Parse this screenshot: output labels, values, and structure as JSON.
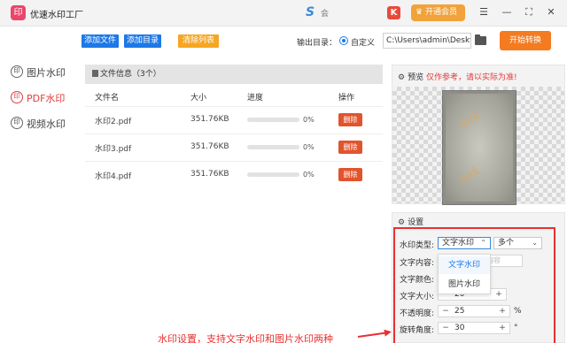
{
  "titlebar": {
    "logo_glyph": "印",
    "app_title": "优速水印工厂",
    "s_icon_glyph": "S",
    "user_label": "会",
    "k_icon_glyph": "K",
    "vip_label": "开通会员",
    "vip_icon": "crown-icon",
    "menu_glyph": "☰",
    "minimize_glyph": "—",
    "maximize_glyph": "⛶",
    "close_glyph": "✕"
  },
  "sidebar": {
    "items": [
      {
        "icon": "印",
        "label": "图片水印",
        "active": false
      },
      {
        "icon": "印",
        "label": "PDF水印",
        "active": true
      },
      {
        "icon": "印",
        "label": "视频水印",
        "active": false
      }
    ]
  },
  "toolbar": {
    "add_file": "添加文件",
    "add_folder": "添加目录",
    "clear_list": "清除列表",
    "output_label": "输出目录：",
    "custom_label": "自定义",
    "output_path": "C:\\Users\\admin\\Deskto",
    "start_label": "开始转换"
  },
  "files": {
    "header": "文件信息（3个）",
    "columns": {
      "name": "文件名",
      "size": "大小",
      "progress": "进度",
      "action": "操作"
    },
    "rows": [
      {
        "name": "水印2.pdf",
        "size": "351.76KB",
        "progress": 0,
        "progress_text": "0%",
        "action": "删除"
      },
      {
        "name": "水印3.pdf",
        "size": "351.76KB",
        "progress": 0,
        "progress_text": "0%",
        "action": "删除"
      },
      {
        "name": "水印4.pdf",
        "size": "351.76KB",
        "progress": 0,
        "progress_text": "0%",
        "action": "删除"
      }
    ]
  },
  "preview": {
    "title": "预览",
    "note": "仅作参考，请以实际为准!",
    "watermark_text": "ank"
  },
  "settings": {
    "title": "设置",
    "type_label": "水印类型:",
    "type_value": "文字水印",
    "count_value": "多个",
    "content_label": "文字内容:",
    "content_placeholder": "印内容",
    "color_label": "文字颜色:",
    "size_label": "文字大小:",
    "size_value": "20",
    "opacity_label": "不透明度:",
    "opacity_value": "25",
    "opacity_unit": "%",
    "rotate_label": "旋转角度:",
    "rotate_value": "30",
    "rotate_unit": "°",
    "dropdown_options": [
      "文字水印",
      "图片水印"
    ]
  },
  "annotation": "水印设置，支持文字水印和图片水印两种",
  "colors": {
    "accent_blue": "#1e78e6",
    "accent_orange": "#f47b20",
    "active_red": "#e03c3c",
    "delete_red": "#e0542e"
  }
}
